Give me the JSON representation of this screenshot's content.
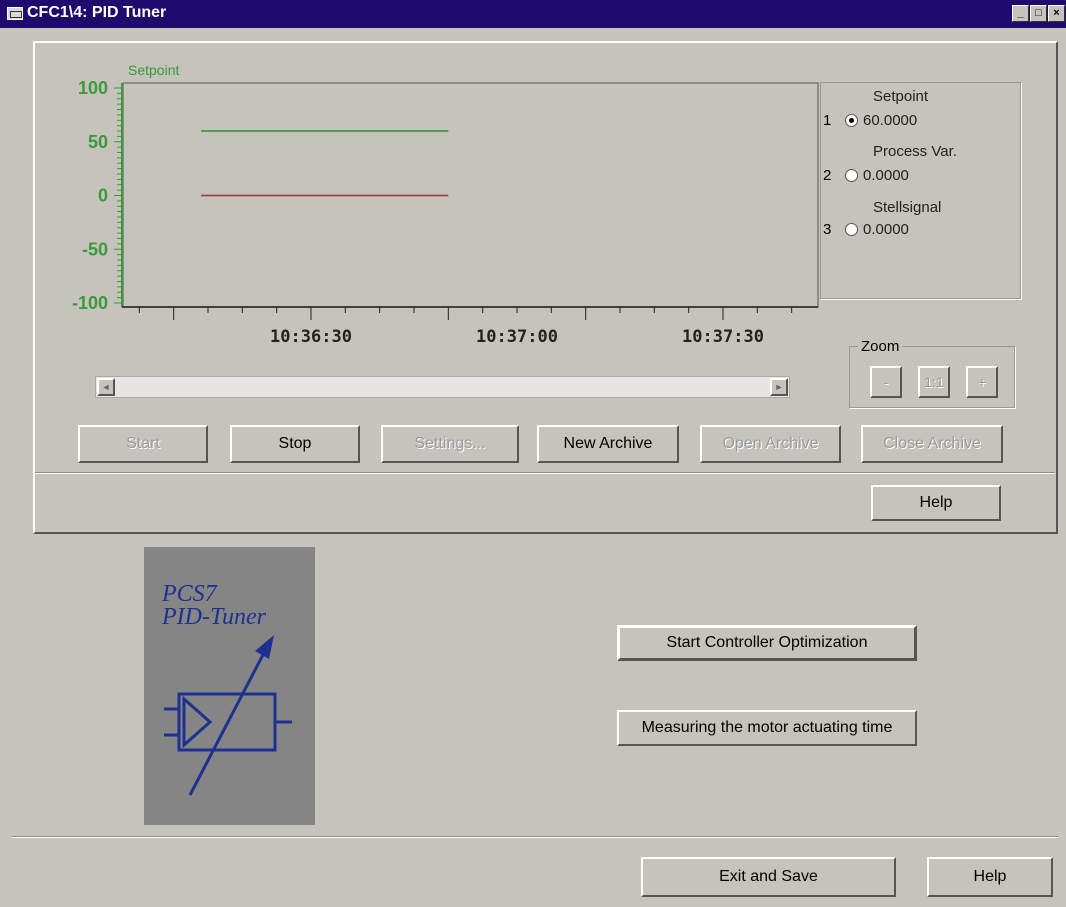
{
  "window": {
    "title": "CFC1\\4: PID Tuner"
  },
  "chart_data": {
    "type": "line",
    "series_label_top": "Setpoint",
    "y_ticks": [
      "100",
      "50",
      "0",
      "-50",
      "-100"
    ],
    "ylim": [
      -100,
      100
    ],
    "x_ticks": [
      "10:36:30",
      "10:37:00",
      "10:37:30"
    ],
    "series": [
      {
        "name": "Setpoint",
        "color": "#3a9a3a",
        "x": [
          "10:36:14",
          "10:36:50"
        ],
        "values": [
          60,
          60
        ]
      },
      {
        "name": "Process Var.",
        "color": "#a04545",
        "x": [
          "10:36:14",
          "10:36:50"
        ],
        "values": [
          0,
          0
        ]
      }
    ],
    "grid": false
  },
  "legend": [
    {
      "num": "1",
      "name": "Setpoint",
      "value": "60.0000",
      "num_color": "#3a9a3a",
      "selected": true
    },
    {
      "num": "2",
      "name": "Process Var.",
      "value": "0.0000",
      "num_color": "#3a9a3a",
      "selected": false
    },
    {
      "num": "3",
      "name": "Stellsignal",
      "value": "0.0000",
      "num_color": "#a04545",
      "selected": false
    }
  ],
  "zoom": {
    "label": "Zoom",
    "minus": "-",
    "reset": "1:1",
    "plus": "+"
  },
  "buttons": {
    "start": "Start",
    "stop": "Stop",
    "settings": "Settings...",
    "new_archive": "New Archive",
    "open_archive": "Open Archive",
    "close_archive": "Close Archive",
    "help_upper": "Help",
    "start_optimization": "Start Controller Optimization",
    "measuring": "Measuring the motor actuating time",
    "exit_save": "Exit and Save",
    "help_lower": "Help"
  },
  "logo": {
    "line1": "PCS7",
    "line2": "PID-Tuner"
  }
}
